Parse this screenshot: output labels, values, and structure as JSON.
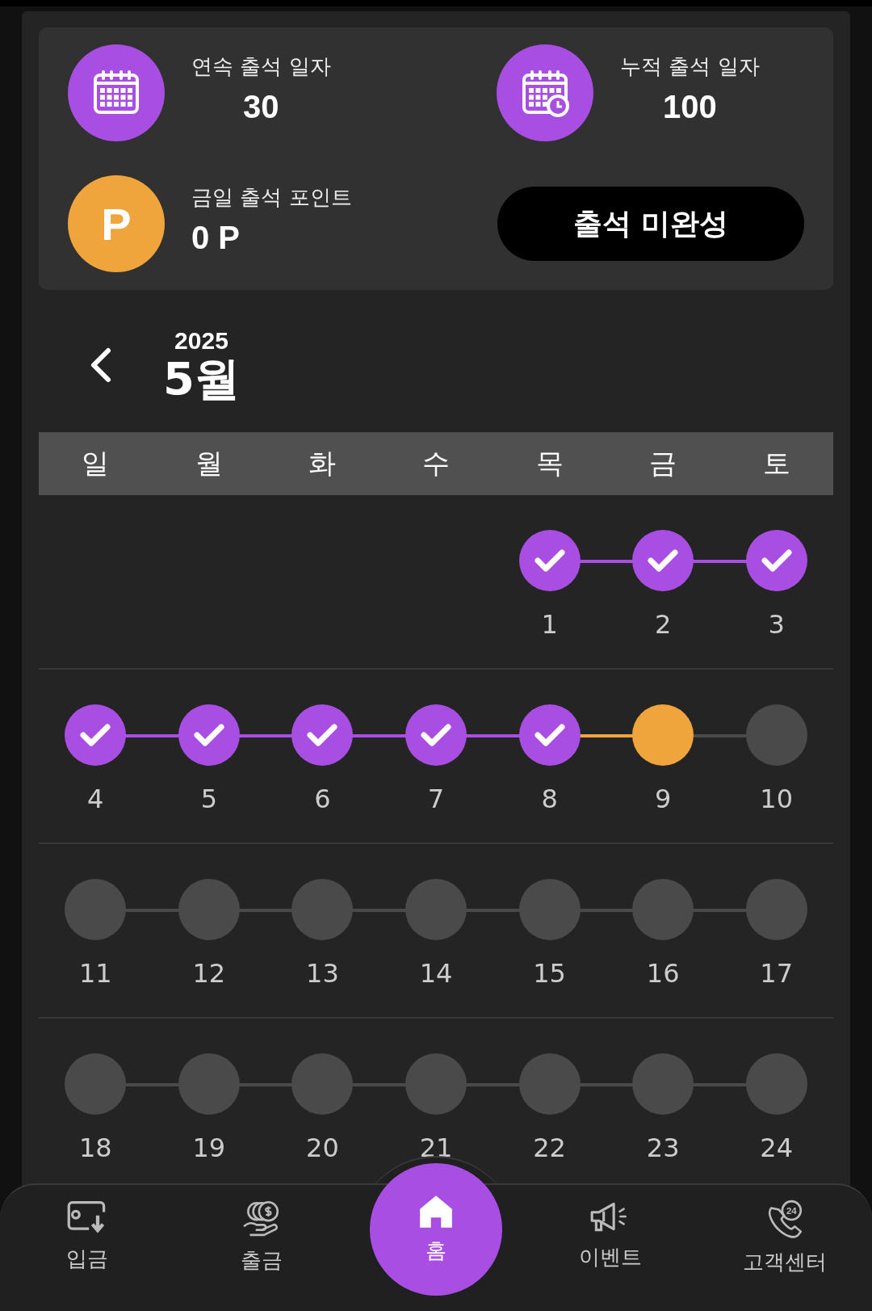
{
  "stats": [
    {
      "kind": "streak",
      "label": "연속 출석 일자",
      "value": "30"
    },
    {
      "kind": "total",
      "label": "누적 출석 일자",
      "value": "100"
    }
  ],
  "points": {
    "badge": "P",
    "label": "금일 출석 포인트",
    "value": "0 P"
  },
  "attend_button": "출석 미완성",
  "calendar": {
    "year": "2025",
    "month": "5월",
    "weekdays": [
      "일",
      "월",
      "화",
      "수",
      "목",
      "금",
      "토"
    ],
    "weeks": [
      [
        {
          "kind": "blank"
        },
        {
          "kind": "blank"
        },
        {
          "kind": "blank"
        },
        {
          "kind": "blank"
        },
        {
          "kind": "day",
          "day": "1",
          "checked": true,
          "today": false
        },
        {
          "kind": "day",
          "day": "2",
          "checked": true,
          "today": false
        },
        {
          "kind": "day",
          "day": "3",
          "checked": true,
          "today": false
        }
      ],
      [
        {
          "kind": "day",
          "day": "4",
          "checked": true,
          "today": false
        },
        {
          "kind": "day",
          "day": "5",
          "checked": true,
          "today": false
        },
        {
          "kind": "day",
          "day": "6",
          "checked": true,
          "today": false
        },
        {
          "kind": "day",
          "day": "7",
          "checked": true,
          "today": false
        },
        {
          "kind": "day",
          "day": "8",
          "checked": true,
          "today": false
        },
        {
          "kind": "day",
          "day": "9",
          "checked": false,
          "today": true
        },
        {
          "kind": "day",
          "day": "10",
          "checked": false,
          "today": false
        }
      ],
      [
        {
          "kind": "day",
          "day": "11",
          "checked": false,
          "today": false
        },
        {
          "kind": "day",
          "day": "12",
          "checked": false,
          "today": false
        },
        {
          "kind": "day",
          "day": "13",
          "checked": false,
          "today": false
        },
        {
          "kind": "day",
          "day": "14",
          "checked": false,
          "today": false
        },
        {
          "kind": "day",
          "day": "15",
          "checked": false,
          "today": false
        },
        {
          "kind": "day",
          "day": "16",
          "checked": false,
          "today": false
        },
        {
          "kind": "day",
          "day": "17",
          "checked": false,
          "today": false
        }
      ],
      [
        {
          "kind": "day",
          "day": "18",
          "checked": false,
          "today": false
        },
        {
          "kind": "day",
          "day": "19",
          "checked": false,
          "today": false
        },
        {
          "kind": "day",
          "day": "20",
          "checked": false,
          "today": false
        },
        {
          "kind": "day",
          "day": "21",
          "checked": false,
          "today": false
        },
        {
          "kind": "day",
          "day": "22",
          "checked": false,
          "today": false
        },
        {
          "kind": "day",
          "day": "23",
          "checked": false,
          "today": false
        },
        {
          "kind": "day",
          "day": "24",
          "checked": false,
          "today": false
        }
      ]
    ]
  },
  "nav": [
    {
      "kind": "deposit",
      "label": "입금",
      "selected": false
    },
    {
      "kind": "withdraw",
      "label": "출금",
      "selected": false
    },
    {
      "kind": "home",
      "label": "홈",
      "selected": true
    },
    {
      "kind": "event",
      "label": "이벤트",
      "selected": false
    },
    {
      "kind": "support",
      "label": "고객센터",
      "selected": false,
      "icon_text": "24"
    }
  ]
}
